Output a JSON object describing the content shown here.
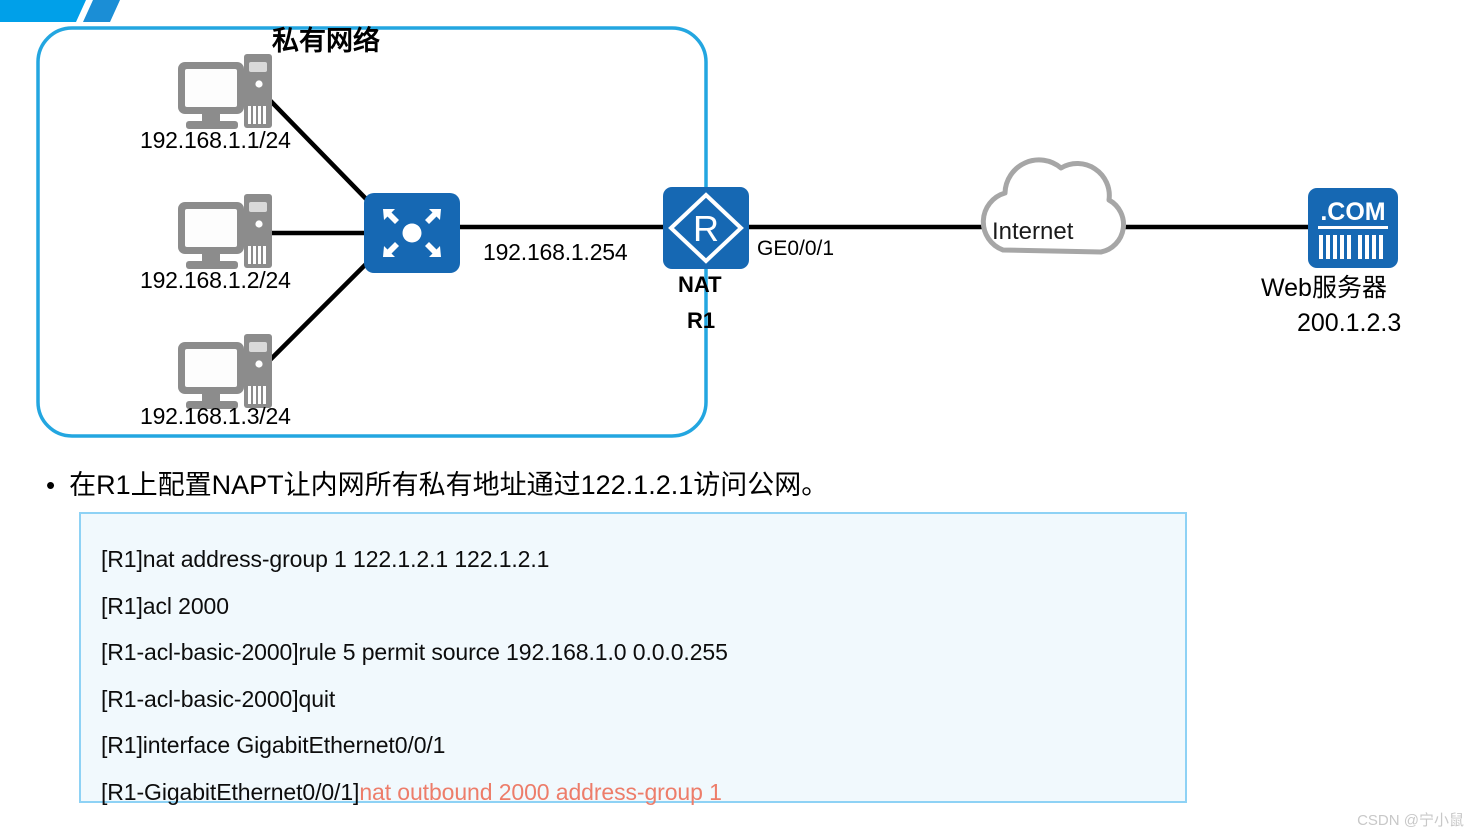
{
  "colors": {
    "device_blue": "#1668b3",
    "network_box_border": "#23a6e0",
    "banner_blue": "#00a0e9",
    "pc_gray": "#8c8c8c",
    "cloud_gray": "#a6a6a6",
    "config_bg": "#f1f9fd",
    "config_border": "#8ed2f5",
    "highlight_red": "#ed7d6a",
    "link_black": "#000000",
    "watermark_gray": "#c8c8c8"
  },
  "diagram": {
    "private_network_label": "私有网络",
    "hosts": [
      {
        "ip": "192.168.1.1/24",
        "icon": "pc-icon"
      },
      {
        "ip": "192.168.1.2/24",
        "icon": "pc-icon"
      },
      {
        "ip": "192.168.1.3/24",
        "icon": "pc-icon"
      }
    ],
    "switch": {
      "icon": "switch-icon"
    },
    "switch_link_label": "192.168.1.254",
    "router": {
      "icon": "router-icon",
      "glyph": "R",
      "line1": "NAT",
      "line2": "R1",
      "interface_label": "GE0/0/1"
    },
    "cloud": {
      "icon": "cloud-icon",
      "label": "Internet"
    },
    "web_server": {
      "icon": "web-server-icon",
      "badge": ".COM",
      "name": "Web服务器",
      "ip": "200.1.2.3"
    }
  },
  "bullet": {
    "marker": "•",
    "text": "在R1上配置NAPT让内网所有私有地址通过122.1.2.1访问公网。"
  },
  "config": {
    "lines": [
      {
        "prompt": "[R1]nat address-group 1 122.1.2.1 122.1.2.1",
        "command": ""
      },
      {
        "prompt": "[R1]acl 2000",
        "command": ""
      },
      {
        "prompt": "[R1-acl-basic-2000]rule 5 permit source 192.168.1.0 0.0.0.255",
        "command": ""
      },
      {
        "prompt": "[R1-acl-basic-2000]quit",
        "command": ""
      },
      {
        "prompt": "[R1]interface GigabitEthernet0/0/1",
        "command": ""
      },
      {
        "prompt": "[R1-GigabitEthernet0/0/1]",
        "command": "nat outbound 2000 address-group 1"
      }
    ]
  },
  "watermark": {
    "text": "CSDN @宁小鼠"
  }
}
